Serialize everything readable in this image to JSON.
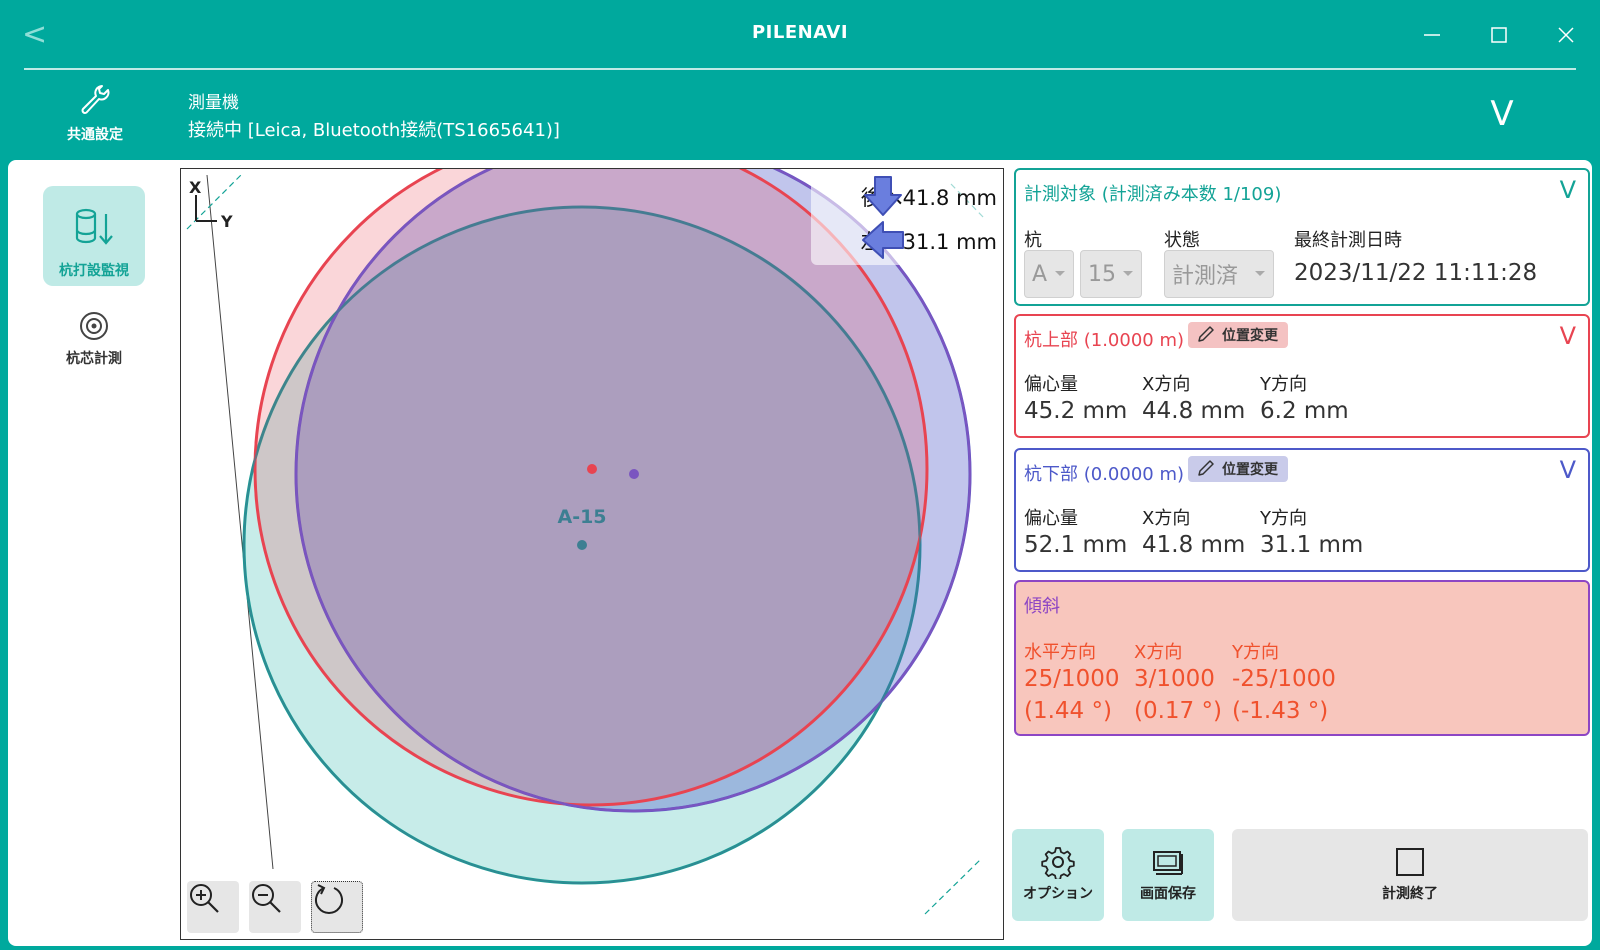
{
  "header": {
    "title": "PILENAVI",
    "back_label": "<"
  },
  "device": {
    "settings_label": "共通設定",
    "title": "測量機",
    "status": "接続中 [Leica, Bluetooth接続(TS1665641)]",
    "expand_label": "V"
  },
  "sidebar": {
    "items": [
      {
        "label": "杭打設監視",
        "active": true
      },
      {
        "label": "杭芯計測",
        "active": false
      }
    ]
  },
  "canvas": {
    "axis_x": "X",
    "axis_y": "Y",
    "pile_label": "A-15",
    "hint_back": "後へ41.8 mm",
    "hint_left": "左へ31.1 mm",
    "colors": {
      "design": "#13a396",
      "top": "#e84451",
      "bottom": "#4d59c9",
      "overlap": "#8d46c4"
    }
  },
  "target": {
    "title": "計測対象 (計測済み本数 1/109)",
    "pile_label": "杭",
    "pile_row": "A",
    "pile_no": "15",
    "state_label": "状態",
    "state_value": "計測済",
    "date_label": "最終計測日時",
    "date_value": "2023/11/22 11:11:28",
    "expand_label": "V"
  },
  "pile_top": {
    "title": "杭上部 (1.0000 m)",
    "pos_button": "位置変更",
    "ecc_label": "偏心量",
    "ecc_value": "45.2 mm",
    "x_label": "X方向",
    "x_value": "44.8 mm",
    "y_label": "Y方向",
    "y_value": "6.2 mm",
    "expand_label": "V"
  },
  "pile_bottom": {
    "title": "杭下部 (0.0000 m)",
    "pos_button": "位置変更",
    "ecc_label": "偏心量",
    "ecc_value": "52.1 mm",
    "x_label": "X方向",
    "x_value": "41.8 mm",
    "y_label": "Y方向",
    "y_value": "31.1 mm",
    "expand_label": "V"
  },
  "tilt": {
    "title": "傾斜",
    "h_label": "水平方向",
    "h_value": "25/1000",
    "h_deg": "(1.44 °)",
    "x_label": "X方向",
    "x_value": "3/1000",
    "x_deg": "(0.17 °)",
    "y_label": "Y方向",
    "y_value": "-25/1000",
    "y_deg": "(-1.43 °)"
  },
  "actions": {
    "options": "オプション",
    "save": "画面保存",
    "end": "計測終了"
  }
}
